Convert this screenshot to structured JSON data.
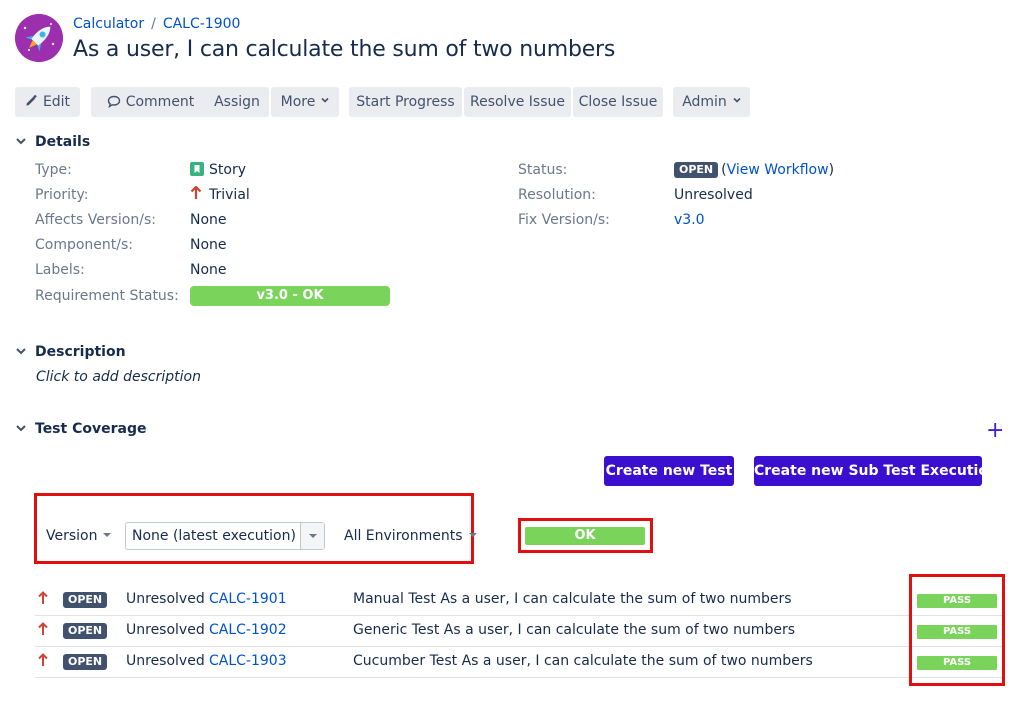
{
  "header": {
    "project": "Calculator",
    "separator": "/",
    "issue_key": "CALC-1900",
    "title": "As a user, I can calculate the sum of two numbers"
  },
  "toolbar": {
    "edit": "Edit",
    "comment": "Comment",
    "assign": "Assign",
    "more": "More",
    "start_progress": "Start Progress",
    "resolve_issue": "Resolve Issue",
    "close_issue": "Close Issue",
    "admin": "Admin"
  },
  "details": {
    "heading": "Details",
    "type_label": "Type:",
    "type_value": "Story",
    "priority_label": "Priority:",
    "priority_value": "Trivial",
    "affects_label": "Affects Version/s:",
    "affects_value": "None",
    "component_label": "Component/s:",
    "component_value": "None",
    "labels_label": "Labels:",
    "labels_value": "None",
    "req_status_label": "Requirement Status:",
    "req_status_value": "v3.0 - OK",
    "status_label": "Status:",
    "status_value": "OPEN",
    "workflow_open": "(",
    "workflow_link": "View Workflow",
    "workflow_close": ")",
    "resolution_label": "Resolution:",
    "resolution_value": "Unresolved",
    "fix_label": "Fix Version/s:",
    "fix_value": "v3.0"
  },
  "description": {
    "heading": "Description",
    "placeholder": "Click to add description"
  },
  "test_coverage": {
    "heading": "Test Coverage",
    "add_symbol": "+",
    "create_test": "Create new Test",
    "create_sub_exec": "Create new Sub Test Execution",
    "version_label": "Version",
    "version_select": "None (latest execution)",
    "environments": "All Environments",
    "overall_status": "OK",
    "tests": [
      {
        "status": "OPEN",
        "resolution": "Unresolved",
        "key": "CALC-1901",
        "summary": "Manual Test As a user, I can calculate the sum of two numbers",
        "result": "PASS"
      },
      {
        "status": "OPEN",
        "resolution": "Unresolved",
        "key": "CALC-1902",
        "summary": "Generic Test As a user, I can calculate the sum of two numbers",
        "result": "PASS"
      },
      {
        "status": "OPEN",
        "resolution": "Unresolved",
        "key": "CALC-1903",
        "summary": "Cucumber Test As a user, I can calculate the sum of two numbers",
        "result": "PASS"
      }
    ]
  },
  "colors": {
    "accent": "#3a0fd0",
    "link": "#0052cc",
    "success": "#7ad35b",
    "highlight": "#e01010",
    "lozenge": "#42526e",
    "priority": "#d04437"
  },
  "icons": {
    "project_avatar": "rocket-icon",
    "edit": "pencil-icon",
    "comment": "speech-bubble-icon",
    "story": "bookmark-icon",
    "priority": "arrow-up-icon",
    "collapse": "chevron-down-icon"
  }
}
